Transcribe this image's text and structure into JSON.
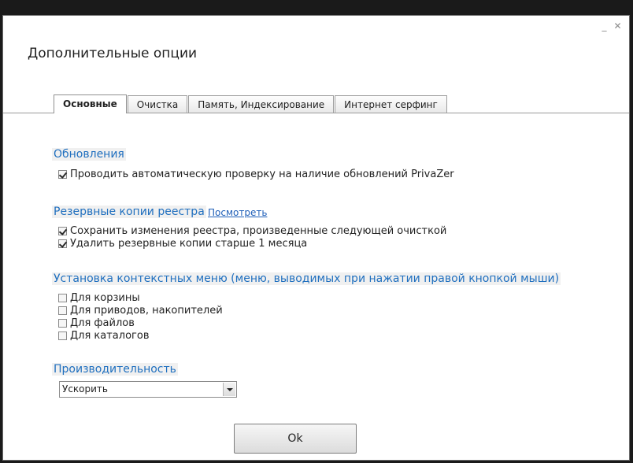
{
  "window": {
    "title": "Дополнительные опции",
    "controls": {
      "minimize": "_",
      "close": "✕"
    }
  },
  "tabs": [
    {
      "label": "Основные",
      "active": true
    },
    {
      "label": "Очистка",
      "active": false
    },
    {
      "label": "Память, Индексирование",
      "active": false
    },
    {
      "label": "Интернет серфинг",
      "active": false
    }
  ],
  "updates": {
    "title": "Обновления",
    "options": [
      {
        "label": "Проводить автоматическую проверку на наличие обновлений PrivaZer",
        "checked": true
      }
    ]
  },
  "registry_backups": {
    "title": "Резервные копии реестра",
    "view_link": "Посмотреть",
    "options": [
      {
        "label": "Сохранить изменения реестра, произведенные следующей очисткой",
        "checked": true
      },
      {
        "label": "Удалить резервные копии старше 1 месяца",
        "checked": true
      }
    ]
  },
  "context_menu": {
    "title": "Установка контекстных меню (меню, выводимых при нажатии правой кнопкой мыши)",
    "options": [
      {
        "label": "Для корзины",
        "checked": false
      },
      {
        "label": "Для приводов, накопителей",
        "checked": false
      },
      {
        "label": "Для файлов",
        "checked": false
      },
      {
        "label": "Для каталогов",
        "checked": false
      }
    ]
  },
  "performance": {
    "title": "Производительность",
    "selected": "Ускорить"
  },
  "footer": {
    "ok_label": "Ok"
  }
}
